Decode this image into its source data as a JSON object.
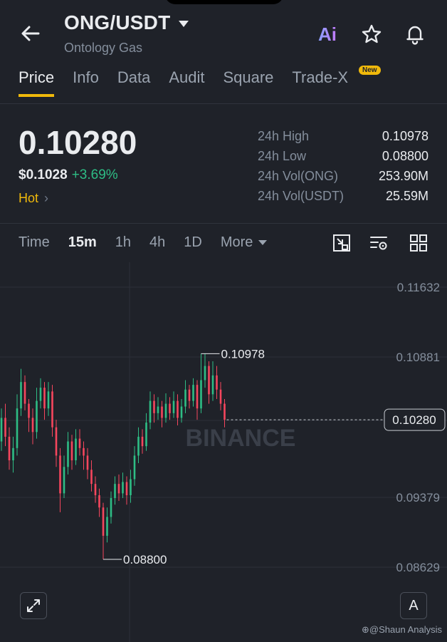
{
  "header": {
    "pair": "ONG/USDT",
    "name": "Ontology Gas"
  },
  "tabs": [
    {
      "label": "Price",
      "active": true
    },
    {
      "label": "Info"
    },
    {
      "label": "Data"
    },
    {
      "label": "Audit"
    },
    {
      "label": "Square"
    },
    {
      "label": "Trade-X"
    }
  ],
  "new_badge": "New",
  "price": {
    "last": "0.10280",
    "usd": "$0.1028",
    "change": "+3.69%",
    "hot": "Hot"
  },
  "stats": [
    {
      "label": "24h High",
      "value": "0.10978"
    },
    {
      "label": "24h Low",
      "value": "0.08800"
    },
    {
      "label": "24h Vol(ONG)",
      "value": "253.90M"
    },
    {
      "label": "24h Vol(USDT)",
      "value": "25.59M"
    }
  ],
  "timeframes": [
    {
      "label": "Time"
    },
    {
      "label": "15m",
      "active": true
    },
    {
      "label": "1h"
    },
    {
      "label": "4h"
    },
    {
      "label": "1D"
    },
    {
      "label": "More"
    }
  ],
  "colors": {
    "up": "#2ebd85",
    "down": "#f6465d",
    "accent": "#f0b90b"
  },
  "chart_data": {
    "type": "candlestick",
    "price_ticks": [
      0.11632,
      0.10881,
      0.1028,
      0.09379,
      0.08629
    ],
    "ylim": [
      0.084,
      0.1195
    ],
    "high_marker": "0.10978",
    "low_marker": "0.08800",
    "current_label": "0.10280",
    "watermark": "BINANCE",
    "candles": [
      [
        0.1005,
        0.103,
        0.104,
        0.0995
      ],
      [
        0.103,
        0.101,
        0.1045,
        0.1
      ],
      [
        0.101,
        0.0985,
        0.102,
        0.0975
      ],
      [
        0.0985,
        0.0998,
        0.101,
        0.0972
      ],
      [
        0.0998,
        0.104,
        0.1055,
        0.099
      ],
      [
        0.104,
        0.1068,
        0.1082,
        0.1032
      ],
      [
        0.1068,
        0.1045,
        0.1075,
        0.1038
      ],
      [
        0.1045,
        0.103,
        0.105,
        0.1015
      ],
      [
        0.103,
        0.1015,
        0.104,
        0.1002
      ],
      [
        0.1015,
        0.1048,
        0.1062,
        0.1008
      ],
      [
        0.1048,
        0.1062,
        0.1072,
        0.104
      ],
      [
        0.1062,
        0.104,
        0.1068,
        0.1028
      ],
      [
        0.104,
        0.1058,
        0.1068,
        0.1032
      ],
      [
        0.1058,
        0.102,
        0.1065,
        0.101
      ],
      [
        0.102,
        0.099,
        0.1028,
        0.0978
      ],
      [
        0.099,
        0.095,
        0.0998,
        0.093
      ],
      [
        0.095,
        0.0978,
        0.099,
        0.0945
      ],
      [
        0.0978,
        0.1005,
        0.1015,
        0.097
      ],
      [
        0.1005,
        0.0985,
        0.1012,
        0.0975
      ],
      [
        0.0985,
        0.1008,
        0.1018,
        0.098
      ],
      [
        0.1008,
        0.0998,
        0.1018,
        0.099
      ],
      [
        0.0998,
        0.099,
        0.1005,
        0.0975
      ],
      [
        0.099,
        0.0975,
        0.0998,
        0.0965
      ],
      [
        0.0975,
        0.096,
        0.0985,
        0.0952
      ],
      [
        0.096,
        0.0948,
        0.0968,
        0.094
      ],
      [
        0.0948,
        0.0935,
        0.0955,
        0.0925
      ],
      [
        0.0935,
        0.0905,
        0.094,
        0.088
      ],
      [
        0.0905,
        0.0925,
        0.0935,
        0.0898
      ],
      [
        0.0925,
        0.0945,
        0.0952,
        0.0918
      ],
      [
        0.0945,
        0.096,
        0.0968,
        0.0938
      ],
      [
        0.096,
        0.095,
        0.097,
        0.0942
      ],
      [
        0.095,
        0.0962,
        0.0972,
        0.0945
      ],
      [
        0.0962,
        0.0948,
        0.0968,
        0.0938
      ],
      [
        0.0948,
        0.0965,
        0.0975,
        0.094
      ],
      [
        0.0965,
        0.099,
        0.1,
        0.0958
      ],
      [
        0.099,
        0.101,
        0.102,
        0.0982
      ],
      [
        0.101,
        0.1,
        0.1018,
        0.0992
      ],
      [
        0.1,
        0.1025,
        0.1035,
        0.0995
      ],
      [
        0.1025,
        0.1048,
        0.1058,
        0.1018
      ],
      [
        0.1048,
        0.1035,
        0.1055,
        0.1025
      ],
      [
        0.1035,
        0.1042,
        0.1052,
        0.1028
      ],
      [
        0.1042,
        0.103,
        0.1048,
        0.102
      ],
      [
        0.103,
        0.1045,
        0.1056,
        0.1025
      ],
      [
        0.1045,
        0.1035,
        0.1052,
        0.1028
      ],
      [
        0.1035,
        0.1048,
        0.1058,
        0.103
      ],
      [
        0.1048,
        0.103,
        0.1055,
        0.1022
      ],
      [
        0.103,
        0.1042,
        0.105,
        0.1025
      ],
      [
        0.1042,
        0.106,
        0.107,
        0.1035
      ],
      [
        0.106,
        0.1048,
        0.1065,
        0.104
      ],
      [
        0.1048,
        0.1065,
        0.1072,
        0.1042
      ],
      [
        0.1065,
        0.104,
        0.107,
        0.1028
      ],
      [
        0.104,
        0.107,
        0.1098,
        0.1035
      ],
      [
        0.107,
        0.1085,
        0.1098,
        0.1062
      ],
      [
        0.1085,
        0.1055,
        0.109,
        0.1045
      ],
      [
        0.1055,
        0.1075,
        0.109,
        0.1048
      ],
      [
        0.1075,
        0.106,
        0.1085,
        0.105
      ],
      [
        0.106,
        0.1045,
        0.1068,
        0.1038
      ],
      [
        0.1045,
        0.1028,
        0.105,
        0.102
      ]
    ]
  }
}
